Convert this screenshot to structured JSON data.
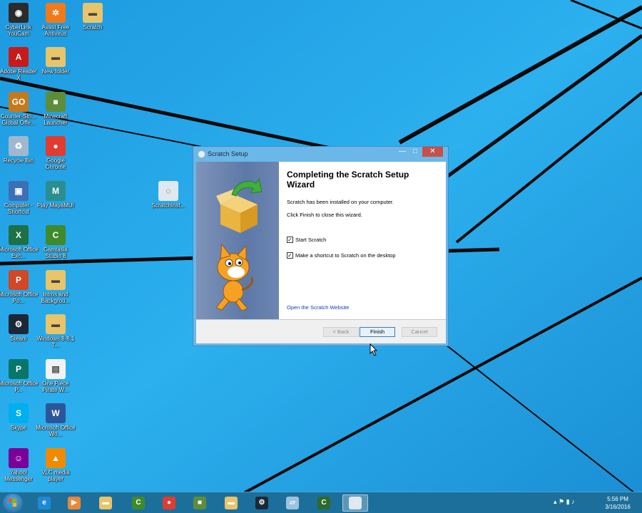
{
  "desktop": {
    "icons": [
      {
        "label": "CyberLink YouCam",
        "icon": "youcam-icon",
        "color": "#2b2b2b",
        "glyph": "◉"
      },
      {
        "label": "Avast Free Antivirus",
        "icon": "avast-icon",
        "color": "#f07a1a",
        "glyph": "✲"
      },
      {
        "label": "Scratch",
        "icon": "folder-icon",
        "color": "#e8c46a",
        "glyph": "▬"
      },
      {
        "label": "Adobe Reader X",
        "icon": "adobe-reader-icon",
        "color": "#c91a1a",
        "glyph": "A"
      },
      {
        "label": "New folder",
        "icon": "folder-icon",
        "color": "#e8c46a",
        "glyph": "▬"
      },
      {
        "label": "Counter-Stri... Global Offe...",
        "icon": "csgo-icon",
        "color": "#c47a1c",
        "glyph": "GO"
      },
      {
        "label": "Minecraft Launcher",
        "icon": "minecraft-icon",
        "color": "#5e8d3a",
        "glyph": "■"
      },
      {
        "label": "Recycle Bin",
        "icon": "recycle-bin-icon",
        "color": "#9fb8cf",
        "glyph": "♻"
      },
      {
        "label": "Google Chrome",
        "icon": "chrome-icon",
        "color": "#e03c31",
        "glyph": "●"
      },
      {
        "label": "Computer - Shortcut",
        "icon": "computer-icon",
        "color": "#3d6fb6",
        "glyph": "▣"
      },
      {
        "label": "Play MayaMUI",
        "icon": "maya-icon",
        "color": "#2a8e8e",
        "glyph": "M"
      },
      {
        "label": "Microsoft Office Exc...",
        "icon": "excel-icon",
        "color": "#1e7145",
        "glyph": "X"
      },
      {
        "label": "Camtasia Studio 8",
        "icon": "camtasia-icon",
        "color": "#3f8a2a",
        "glyph": "C"
      },
      {
        "label": "Microsoft Office Po...",
        "icon": "powerpoint-icon",
        "color": "#d24726",
        "glyph": "P"
      },
      {
        "label": "Intros and Backgrou...",
        "icon": "folder-icon",
        "color": "#e8c46a",
        "glyph": "▬"
      },
      {
        "label": "Steam",
        "icon": "steam-icon",
        "color": "#1b2838",
        "glyph": "⚙"
      },
      {
        "label": "Windows 8-8.1 T...",
        "icon": "folder-icon",
        "color": "#e8c46a",
        "glyph": "▬"
      },
      {
        "label": "Microsoft Office P...",
        "icon": "publisher-icon",
        "color": "#077568",
        "glyph": "P"
      },
      {
        "label": "One Piece Pirate W...",
        "icon": "document-icon",
        "color": "#f2f2f2",
        "glyph": "▤"
      },
      {
        "label": "Skype",
        "icon": "skype-icon",
        "color": "#00aff0",
        "glyph": "S"
      },
      {
        "label": "Microsoft Office Wo...",
        "icon": "word-icon",
        "color": "#2b579a",
        "glyph": "W"
      },
      {
        "label": "Yahoo! Messenger",
        "icon": "yahoo-messenger-icon",
        "color": "#7b0099",
        "glyph": "☺"
      },
      {
        "label": "VLC media player",
        "icon": "vlc-icon",
        "color": "#f08a00",
        "glyph": "▲"
      },
      {
        "label": "ScratchInst...",
        "icon": "scratch-installer-icon",
        "color": "#dfe8ef",
        "glyph": "◌"
      }
    ]
  },
  "dialog": {
    "title": "Scratch Setup",
    "minimize_glyph": "—",
    "maximize_glyph": "□",
    "close_glyph": "✕",
    "heading": "Completing the Scratch Setup Wizard",
    "installed_text": "Scratch has been installed on your computer.",
    "finish_text": "Click Finish to close this wizard.",
    "start_scratch": {
      "label": "Start Scratch",
      "checked": true
    },
    "shortcut": {
      "label": "Make a shortcut to Scratch on the desktop",
      "checked": true
    },
    "check_glyph": "✓",
    "website_link": "Open the Scratch Website",
    "back_label": "< Back",
    "finish_label": "Finish",
    "cancel_label": "Cancel"
  },
  "taskbar": {
    "apps": [
      {
        "icon": "internet-explorer-icon",
        "color": "#1e8ad6",
        "glyph": "e"
      },
      {
        "icon": "media-player-icon",
        "color": "#e8883a",
        "glyph": "▶"
      },
      {
        "icon": "file-explorer-icon",
        "color": "#e8c46a",
        "glyph": "▬"
      },
      {
        "icon": "camtasia-icon",
        "color": "#3f8a2a",
        "glyph": "C"
      },
      {
        "icon": "chrome-icon",
        "color": "#e03c31",
        "glyph": "●"
      },
      {
        "icon": "minecraft-icon",
        "color": "#5e8d3a",
        "glyph": "■"
      },
      {
        "icon": "folder-icon",
        "color": "#e8c46a",
        "glyph": "▬"
      },
      {
        "icon": "steam-icon",
        "color": "#1b2838",
        "glyph": "⚙"
      },
      {
        "icon": "notepad-icon",
        "color": "#9cc3dd",
        "glyph": "▱"
      },
      {
        "icon": "camtasia-recorder-icon",
        "color": "#2d6a2d",
        "glyph": "C"
      },
      {
        "icon": "scratch-setup-icon",
        "color": "#dfe8ef",
        "glyph": "◌"
      }
    ],
    "tray_glyphs": "▴  ⚑  ▮  ♪",
    "time": "5:56 PM",
    "date": "3/16/2016"
  },
  "colors": {
    "wallpaper_light": "#34b5ef",
    "wallpaper_dark": "#1a8fd6",
    "taskbar": "#1d6f9b",
    "dialog_frame": "#6ab7e8"
  }
}
